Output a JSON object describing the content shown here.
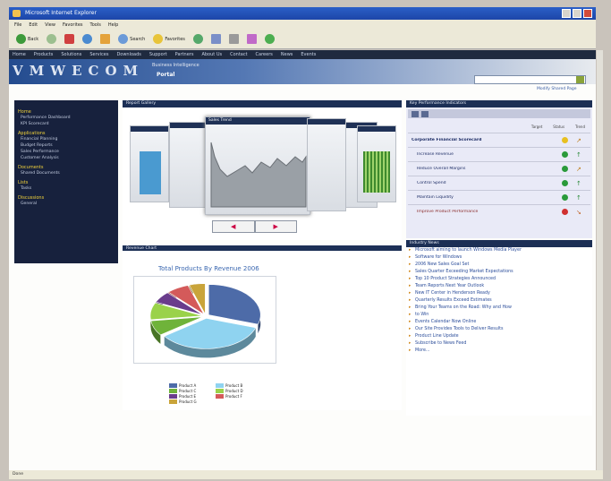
{
  "browser": {
    "title": "Microsoft Internet Explorer",
    "menu": [
      "File",
      "Edit",
      "View",
      "Favorites",
      "Tools",
      "Help"
    ],
    "toolbar": {
      "back": "Back",
      "search": "Search",
      "favorites": "Favorites"
    },
    "status": "Done"
  },
  "site": {
    "nav": [
      "Home",
      "Products",
      "Solutions",
      "Services",
      "Downloads",
      "Support",
      "Partners",
      "About Us",
      "Contact",
      "Careers",
      "News",
      "Events"
    ],
    "logo": "VMWECOM",
    "banner_sub": "Business Intelligence",
    "banner_sub2": "Portal",
    "top_link": "Modify Shared Page"
  },
  "left_nav": [
    {
      "group": "Home",
      "links": [
        "Performance Dashboard",
        "KPI Scorecard"
      ]
    },
    {
      "group": "Applications",
      "links": [
        "Financial Planning",
        "Budget Reports",
        "Sales Performance",
        "Customer Analysis"
      ]
    },
    {
      "group": "Documents",
      "links": [
        "Shared Documents"
      ]
    },
    {
      "group": "Lists",
      "links": [
        "Tasks"
      ]
    },
    {
      "group": "Discussions",
      "links": [
        "General"
      ]
    }
  ],
  "carousel": {
    "header": "Report Gallery",
    "card_title": "Sales Trend",
    "prev": "◀",
    "next": "▶"
  },
  "pie": {
    "header": "Revenue Chart",
    "title": "Total Products By Revenue 2006",
    "legend": [
      "Product A",
      "Product B",
      "Product C",
      "Product D",
      "Product E",
      "Product F",
      "Product G"
    ]
  },
  "kpi": {
    "header": "Key Performance Indicators",
    "col_target": "Target",
    "col_status": "Status",
    "col_trend": "Trend",
    "rows": [
      {
        "name": "Corporate Financial Scorecard",
        "status": "#e8c020",
        "trend": "↗"
      },
      {
        "name": "Increase Revenue",
        "status": "#2a9a3a",
        "trend": "↑"
      },
      {
        "name": "Reduce Overall Margins",
        "status": "#2a9a3a",
        "trend": "↗"
      },
      {
        "name": "Control Spend",
        "status": "#2a9a3a",
        "trend": "↑"
      },
      {
        "name": "Maintain Liquidity",
        "status": "#2a9a3a",
        "trend": "↑"
      },
      {
        "name": "Improve Product Performance",
        "status": "#d03030",
        "trend": "↘"
      }
    ]
  },
  "news": {
    "header": "Industry News",
    "items": [
      "Microsoft aiming to launch Windows Media Player",
      "Software for Windows",
      "2006 New Sales Goal Set",
      "Sales Quarter Exceeding Market Expectations",
      "Top 10 Product Strategies Announced",
      "Team Reports Next Year Outlook",
      "New IT Center in Henderson Ready",
      "Quarterly Results Exceed Estimates",
      "Bring Your Teams on the Road: Why and How",
      "to Win",
      "Events Calendar Now Online",
      "Our Site Provides Tools to Deliver Results",
      "Product Line Update",
      "Subscribe to News Feed",
      "More..."
    ]
  },
  "chart_data": {
    "type": "pie",
    "title": "Total Products By Revenue 2006",
    "categories": [
      "Product A",
      "Product B",
      "Product C",
      "Product D",
      "Product E",
      "Product F",
      "Product G"
    ],
    "values": [
      30,
      35,
      8,
      9,
      6,
      7,
      5
    ],
    "colors": [
      "#4d6ba8",
      "#8fd3f0",
      "#6fb33a",
      "#9ad24a",
      "#6a3c8c",
      "#d45a5a",
      "#c9a43a"
    ]
  }
}
